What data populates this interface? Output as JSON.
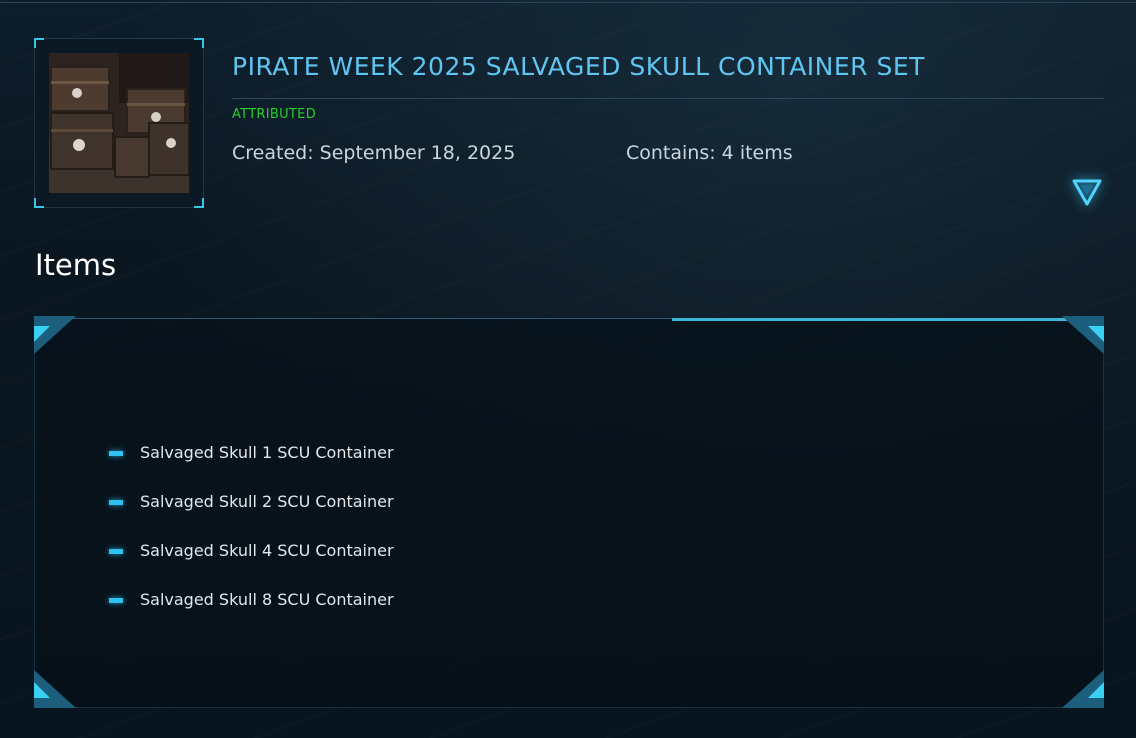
{
  "pledge": {
    "title": "PIRATE WEEK 2025 SALVAGED SKULL CONTAINER SET",
    "status": "ATTRIBUTED",
    "created": "Created: September 18, 2025",
    "contains": "Contains: 4 items",
    "thumbnail_alt": "Salvaged skull containers"
  },
  "items_section": {
    "heading": "Items",
    "items": [
      {
        "label": "Salvaged Skull 1 SCU Container"
      },
      {
        "label": "Salvaged Skull 2 SCU Container"
      },
      {
        "label": "Salvaged Skull 4 SCU Container"
      },
      {
        "label": "Salvaged Skull 8 SCU Container"
      }
    ]
  },
  "icons": {
    "expand_toggle": "triangle-down-icon",
    "bullet": "dash-bullet-icon"
  },
  "colors": {
    "accent": "#38c6e6",
    "title": "#5fc6f2",
    "status": "#22d02a",
    "background": "#0a1722"
  }
}
